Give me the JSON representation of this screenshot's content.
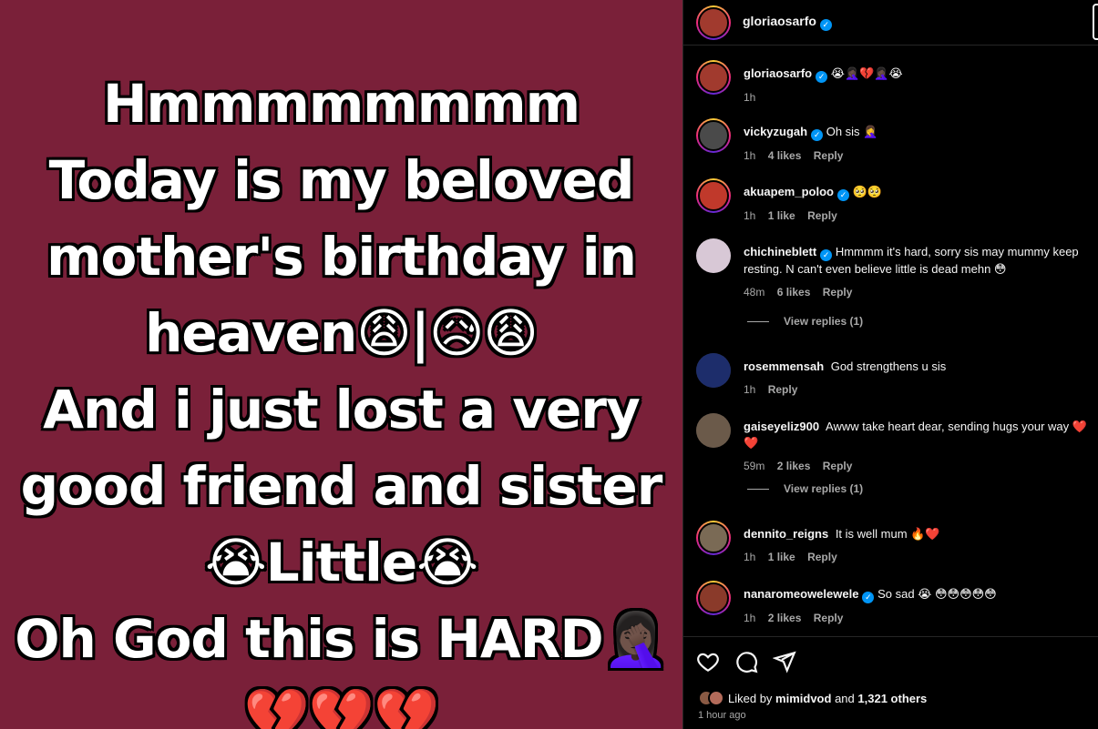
{
  "post": {
    "lines": [
      "Hmmmmmmmm",
      "Today is my beloved",
      "mother's birthday in",
      "heaven😩|😥😩",
      "And i just lost a very",
      "good friend and sister",
      "😭Little😭",
      "Oh God this is HARD🤦🏿‍♀️",
      "💔💔💔"
    ]
  },
  "header": {
    "username": "gloriaosarfo"
  },
  "comments": [
    {
      "user": "gloriaosarfo",
      "verified": true,
      "text": "😭🤦🏿‍♀️💔🤦🏿‍♀️😭",
      "time": "1h",
      "likes": "",
      "reply": ""
    },
    {
      "user": "vickyzugah",
      "verified": true,
      "text": "Oh sis 🤦‍♀️",
      "time": "1h",
      "likes": "4 likes",
      "reply": "Reply"
    },
    {
      "user": "akuapem_poloo",
      "verified": true,
      "text": "🥺🥺",
      "time": "1h",
      "likes": "1 like",
      "reply": "Reply"
    },
    {
      "user": "chichineblett",
      "verified": true,
      "text": "Hmmmm it's hard, sorry sis may mummy keep resting. N can't even believe little is dead mehn 😳",
      "time": "48m",
      "likes": "6 likes",
      "reply": "Reply",
      "view_replies": "View replies (1)"
    },
    {
      "user": "rosemmensah",
      "verified": false,
      "text": "God strengthens u sis",
      "time": "1h",
      "likes": "",
      "reply": "Reply"
    },
    {
      "user": "gaiseyeliz900",
      "verified": false,
      "text": "Awww take heart dear, sending hugs your way ❤️❤️",
      "time": "59m",
      "likes": "2 likes",
      "reply": "Reply",
      "view_replies": "View replies (1)"
    },
    {
      "user": "dennito_reigns",
      "verified": false,
      "text": "It is well mum 🔥❤️",
      "time": "1h",
      "likes": "1 like",
      "reply": "Reply"
    },
    {
      "user": "nanaromeowelewele",
      "verified": true,
      "text": "So sad 😭 😳😳😳😳😳",
      "time": "1h",
      "likes": "2 likes",
      "reply": "Reply"
    }
  ],
  "footer": {
    "liked_prefix": "Liked by",
    "liked_user": "mimidvod",
    "liked_and": "and",
    "liked_others": "1,321 others",
    "time_ago": "1 hour ago"
  },
  "colors": {
    "post_bg": "#7a2039",
    "accent": "#0095f6",
    "muted": "#a8a8a8"
  },
  "icons": [
    "heart-icon",
    "comment-icon",
    "share-icon",
    "verified-icon"
  ]
}
